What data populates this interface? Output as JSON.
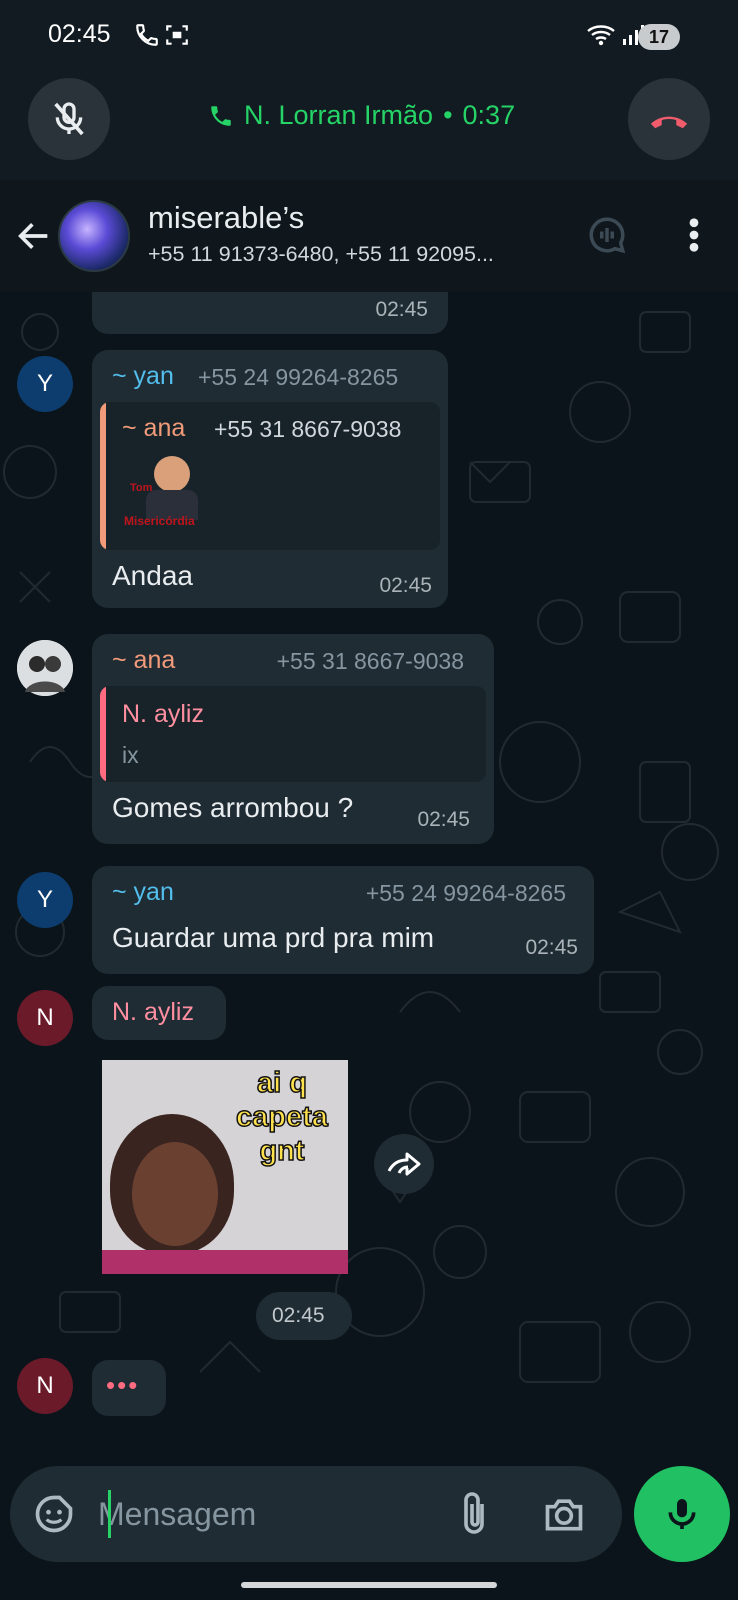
{
  "status_bar": {
    "time": "02:45",
    "battery": "17"
  },
  "call": {
    "caller": "N. Lorran Irmão",
    "duration": "0:37"
  },
  "header": {
    "title": "miserable’s",
    "members": "+55 11 91373-6480, +55 11 92095..."
  },
  "messages": [
    {
      "time": "02:45"
    },
    {
      "avatar": "Y",
      "sender": "~ yan",
      "phone": "+55 24 99264-8265",
      "quote": {
        "sender": "~ ana",
        "phone": "+55 31 8667-9038",
        "sticker_text_1": "Tom",
        "sticker_text_2": "Misericórdia"
      },
      "text": "Andaa",
      "time": "02:45"
    },
    {
      "sender": "~ ana",
      "phone": "+55 31 8667-9038",
      "quote": {
        "sender": "N. ayliz",
        "text": "ix"
      },
      "text": "Gomes arrombou ?",
      "time": "02:45"
    },
    {
      "avatar": "Y",
      "sender": "~ yan",
      "phone": "+55 24 99264-8265",
      "text": "Guardar uma prd pra mim",
      "time": "02:45"
    },
    {
      "avatar": "N",
      "sender": "N. ayliz",
      "sticker_caption": "ai q capeta gnt",
      "time": "02:45"
    },
    {
      "avatar": "N",
      "typing": "•••"
    }
  ],
  "input": {
    "placeholder": "Mensagem"
  },
  "colors": {
    "accent_green": "#25d366",
    "yan_color": "#53bdeb",
    "ana_color": "#f29b7a",
    "ayliz_color": "#ff6b81",
    "end_call_red": "#f15c6d"
  }
}
